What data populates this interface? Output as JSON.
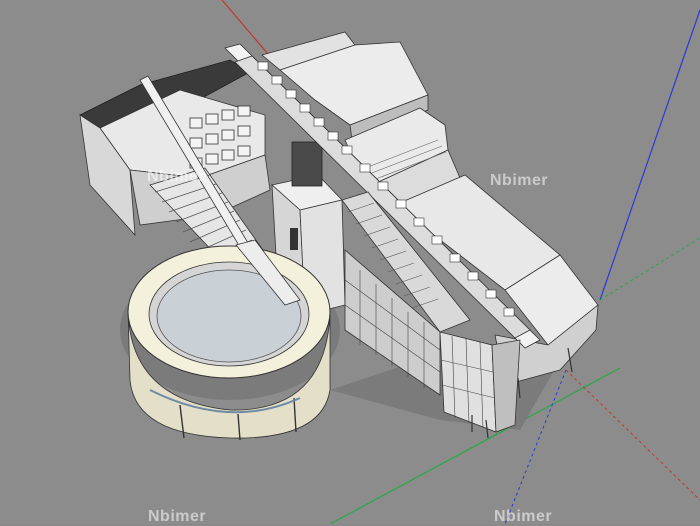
{
  "watermark": {
    "text": "Nbimer"
  },
  "scene": {
    "background_color": "#8c8c8c",
    "axis_colors": {
      "x": "#c0392b",
      "y": "#27a844",
      "z": "#2b3bd6"
    }
  }
}
